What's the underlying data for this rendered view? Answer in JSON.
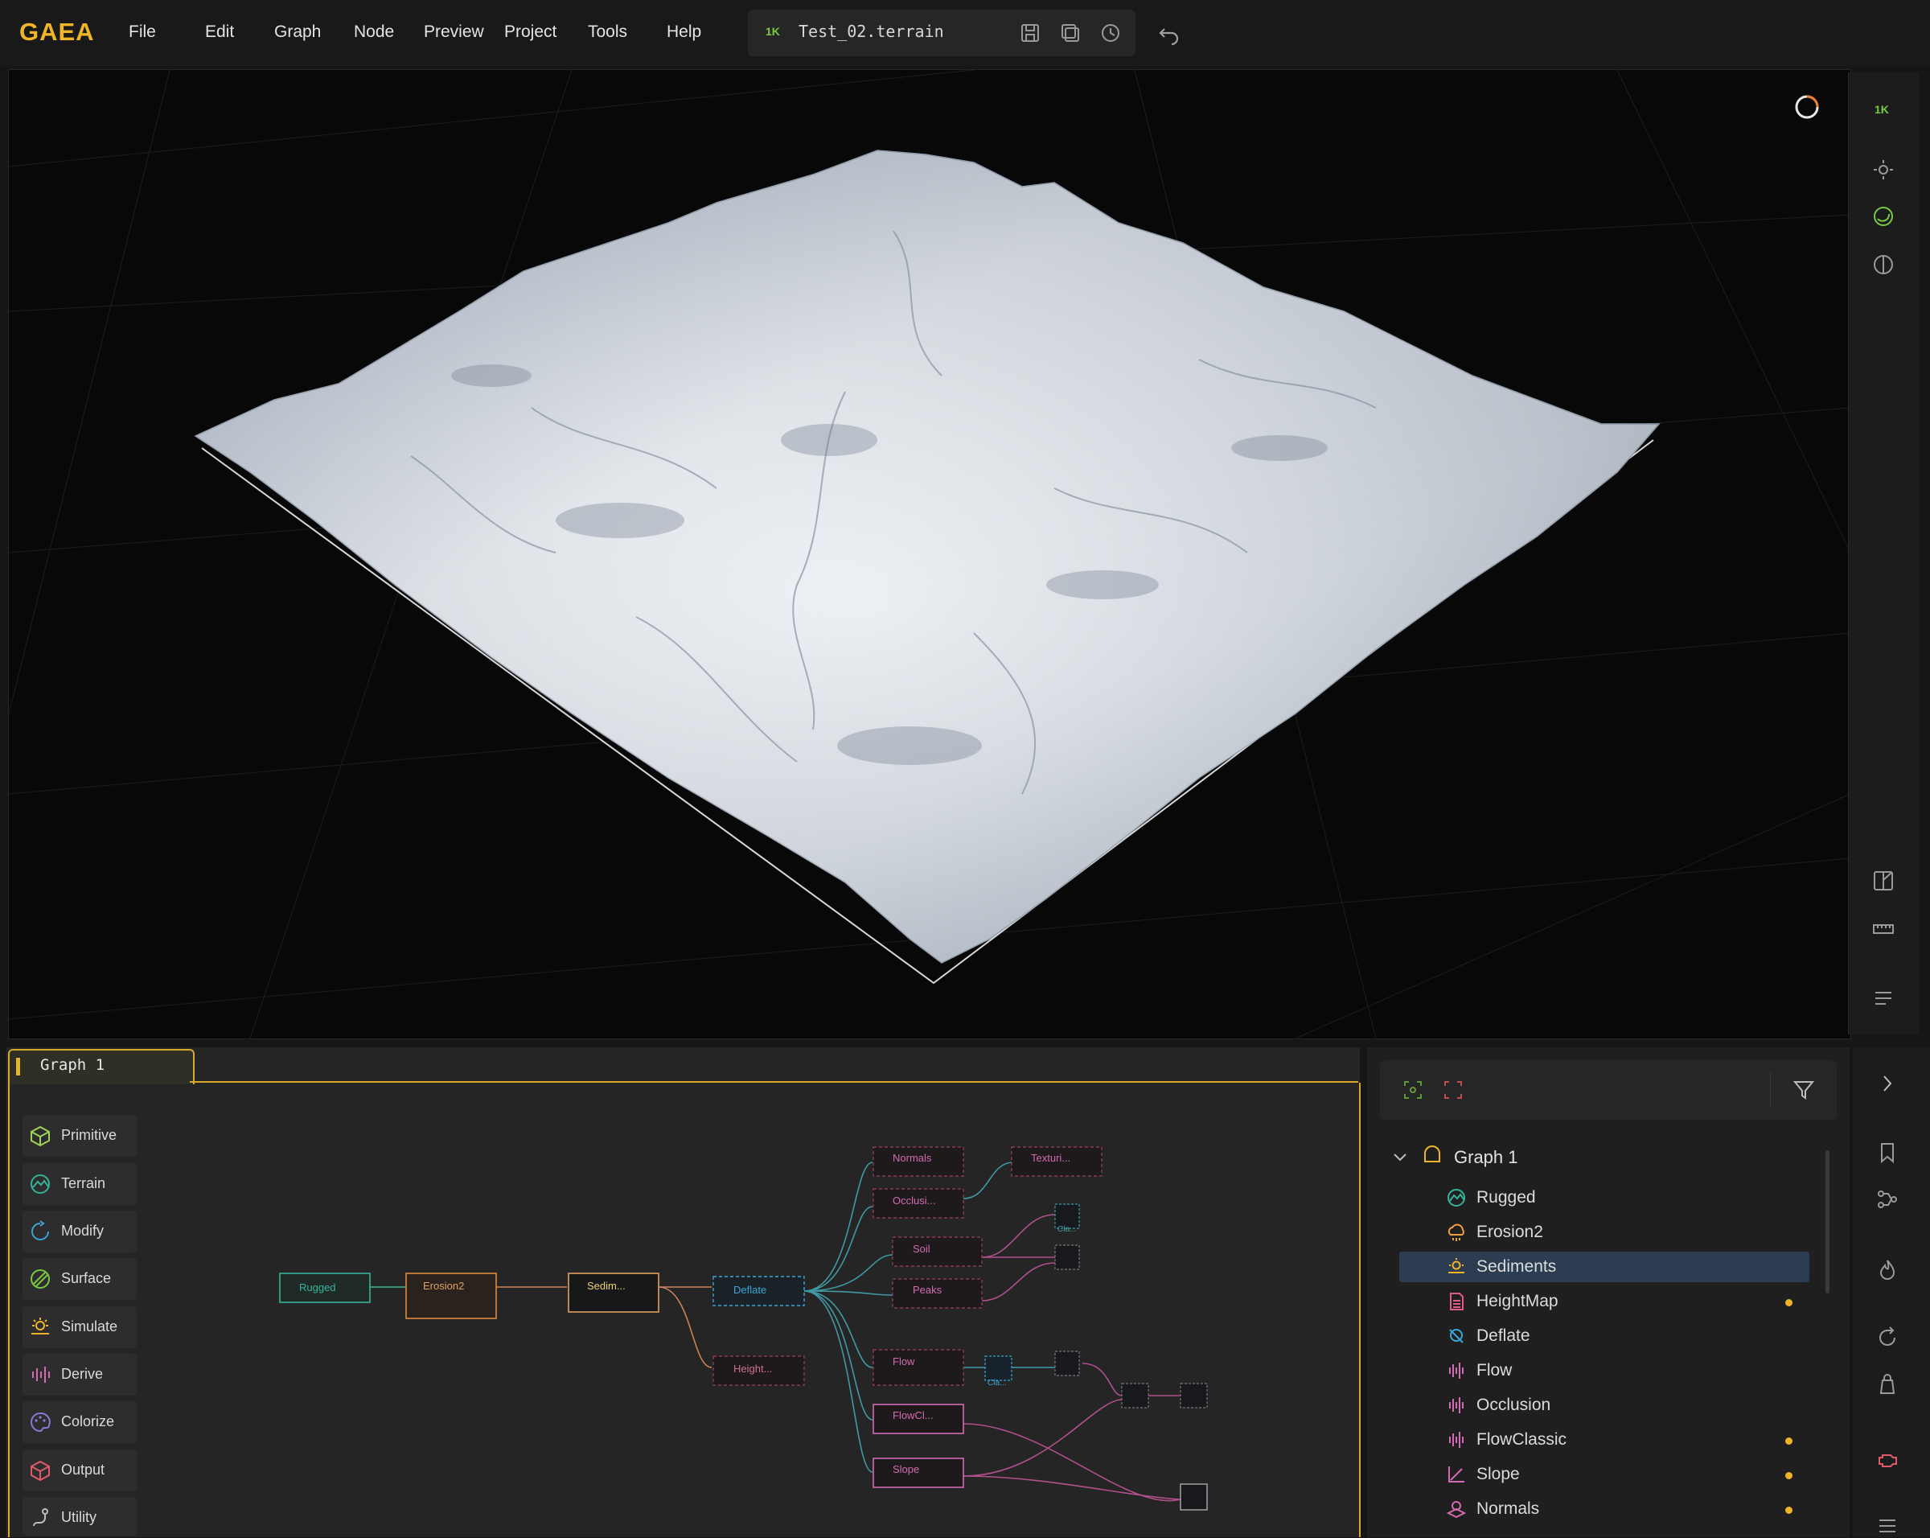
{
  "app": {
    "logo": "GAEA",
    "menu": [
      "File",
      "Edit",
      "Graph",
      "Node",
      "Preview",
      "Project",
      "Tools",
      "Help"
    ]
  },
  "file": {
    "resolution": "1K",
    "name": "Test_02.terrain"
  },
  "viewport": {
    "resolution_badge": "1K",
    "accent": "#7ac943"
  },
  "graph_tab": {
    "label": "Graph 1"
  },
  "categories": [
    {
      "label": "Primitive",
      "icon": "cube-icon",
      "color": "#9fd356"
    },
    {
      "label": "Terrain",
      "icon": "terrain-icon",
      "color": "#36b39a"
    },
    {
      "label": "Modify",
      "icon": "modify-icon",
      "color": "#3aa6d8"
    },
    {
      "label": "Surface",
      "icon": "surface-icon",
      "color": "#7ac943"
    },
    {
      "label": "Simulate",
      "icon": "simulate-icon",
      "color": "#f0b429"
    },
    {
      "label": "Derive",
      "icon": "derive-icon",
      "color": "#d36ab2"
    },
    {
      "label": "Colorize",
      "icon": "palette-icon",
      "color": "#8a7ad8"
    },
    {
      "label": "Output",
      "icon": "output-icon",
      "color": "#e05a6a"
    },
    {
      "label": "Utility",
      "icon": "utility-icon",
      "color": "#bdbdbd"
    }
  ],
  "graph_nodes": {
    "rugged": "Rugged",
    "erosion2": "Erosion2",
    "sediments": "Sedim...",
    "deflate": "Deflate",
    "height": "Height...",
    "normals": "Normals",
    "occlusion": "Occlusi...",
    "texturing": "Texturi...",
    "soil": "Soil",
    "peaks": "Peaks",
    "flow": "Flow",
    "flowclassic": "FlowCl...",
    "slope": "Slope",
    "clamp1": "Cla...",
    "clamp2": "Cla..."
  },
  "tree": {
    "root": "Graph 1",
    "items": [
      {
        "label": "Rugged",
        "icon": "rugged-icon",
        "color": "#36b39a",
        "flag": false
      },
      {
        "label": "Erosion2",
        "icon": "erosion-icon",
        "color": "#f0a040",
        "flag": false
      },
      {
        "label": "Sediments",
        "icon": "sediments-icon",
        "color": "#f0b429",
        "flag": false,
        "selected": true
      },
      {
        "label": "HeightMap",
        "icon": "heightmap-icon",
        "color": "#e05a8a",
        "flag": true
      },
      {
        "label": "Deflate",
        "icon": "deflate-icon",
        "color": "#3aa6d8",
        "flag": false
      },
      {
        "label": "Flow",
        "icon": "flow-icon",
        "color": "#d36ab2",
        "flag": false
      },
      {
        "label": "Occlusion",
        "icon": "occlusion-icon",
        "color": "#d36ab2",
        "flag": false
      },
      {
        "label": "FlowClassic",
        "icon": "flowclassic-icon",
        "color": "#d36ab2",
        "flag": true
      },
      {
        "label": "Slope",
        "icon": "slope-icon",
        "color": "#d36ab2",
        "flag": true
      },
      {
        "label": "Normals",
        "icon": "normals-icon",
        "color": "#d36ab2",
        "flag": true
      }
    ]
  }
}
